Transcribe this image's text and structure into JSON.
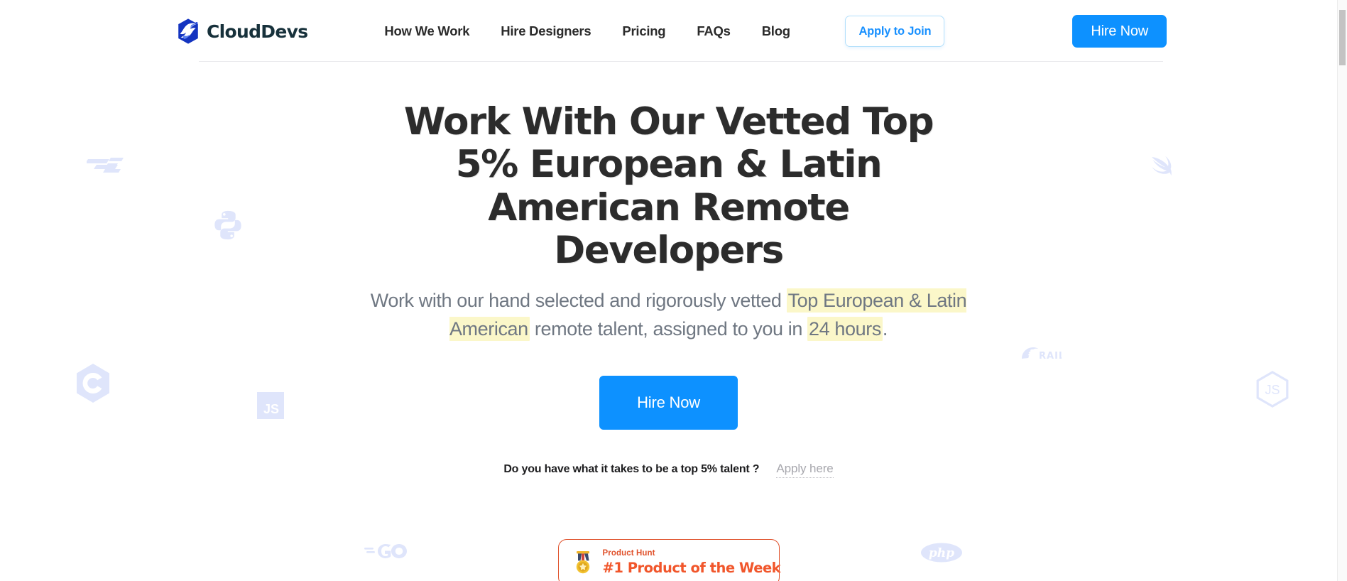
{
  "brand": {
    "name": "CloudDevs",
    "logo_icon": "clouddevs-logo-icon",
    "accent_color": "#1a3fc4"
  },
  "header": {
    "nav": [
      {
        "label": "How We Work"
      },
      {
        "label": "Hire Designers"
      },
      {
        "label": "Pricing"
      },
      {
        "label": "FAQs"
      },
      {
        "label": "Blog"
      }
    ],
    "apply_to_join_label": "Apply to Join",
    "hire_now_label": "Hire Now",
    "primary_color": "#0d91ff",
    "outline_color": "#b4e0fb"
  },
  "hero": {
    "title": "Work With Our Vetted Top 5% European & Latin American Remote Developers",
    "subtitle": {
      "part1": "Work with our hand selected and rigorously vetted ",
      "highlight1": "Top European & Latin American",
      "part2": " remote talent, assigned to you in ",
      "highlight2": "24 hours",
      "part3": ".",
      "highlight_color": "#fbf7c9"
    },
    "cta_label": "Hire Now",
    "apply_question": "Do you have what it takes to be a top 5% talent  ?",
    "apply_link_label": "Apply here"
  },
  "badge": {
    "icon": "medal-icon",
    "label": "Product Hunt",
    "title": "#1 Product of the Week",
    "border_color": "#e0522c",
    "text_color": "#f1562b"
  },
  "background_logos": [
    {
      "name": "zend-framework-logo-icon",
      "label": "ZF"
    },
    {
      "name": "python-logo-icon",
      "label": "Python"
    },
    {
      "name": "c-logo-icon",
      "label": "C"
    },
    {
      "name": "javascript-logo-icon",
      "label": "JS"
    },
    {
      "name": "go-logo-icon",
      "label": "GO"
    },
    {
      "name": "swift-logo-icon",
      "label": "Swift"
    },
    {
      "name": "rails-logo-icon",
      "label": "RAILS"
    },
    {
      "name": "nodejs-logo-icon",
      "label": "JS"
    },
    {
      "name": "php-logo-icon",
      "label": "php"
    }
  ]
}
